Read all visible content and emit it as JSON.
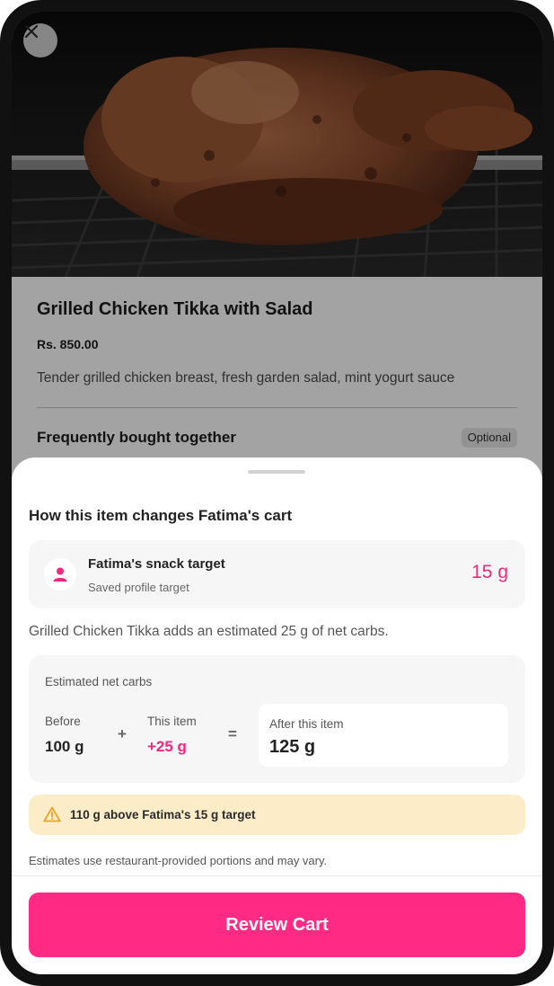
{
  "colors": {
    "accent": "#fe2a84",
    "accent_text": "#f0287e",
    "warning_bg": "#fdecc8",
    "warning_icon": "#e8a42a"
  },
  "hero": {
    "close_icon": "close-icon",
    "image": "grilled-chicken-on-rotisserie-photo"
  },
  "product": {
    "name": "Grilled Chicken Tikka with Salad",
    "price": "Rs. 850.00",
    "description": "Tender grilled chicken breast, fresh garden salad, mint yogurt sauce",
    "fbt_title": "Frequently bought together",
    "optional_badge": "Optional"
  },
  "sheet": {
    "title": "How this item changes Fatima's cart",
    "target": {
      "icon": "user-icon",
      "label": "Fatima's snack target",
      "sublabel": "Saved profile target",
      "value": "15 g"
    },
    "adds_text": "Grilled Chicken Tikka adds an estimated 25 g of net carbs.",
    "carbs": {
      "label": "Estimated net carbs",
      "before_label": "Before",
      "before_value": "100 g",
      "plus": "+",
      "this_label": "This item",
      "this_value": "+25 g",
      "equals": "=",
      "after_label": "After this item",
      "after_value": "125 g"
    },
    "warning": {
      "icon": "warning-triangle-icon",
      "text": "110 g above Fatima's 15 g target"
    },
    "note": "Estimates use restaurant-provided portions and may vary.",
    "cta_label": "Review Cart"
  }
}
